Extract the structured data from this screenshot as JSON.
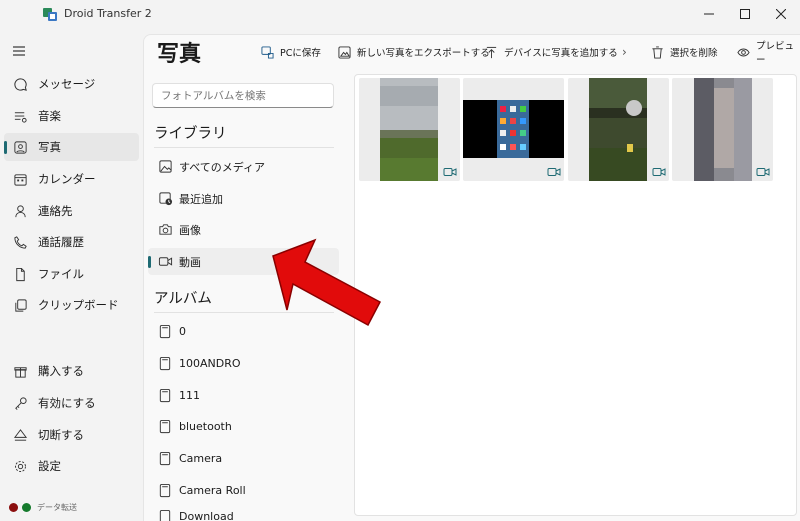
{
  "app": {
    "title": "Droid Transfer 2"
  },
  "colors": {
    "accent": "#1e6a73",
    "arrow": "#e10b0b",
    "status_red": "#8b0e0e",
    "status_green": "#157a2c"
  },
  "sidebar": {
    "items": [
      {
        "label": "メッセージ",
        "icon": "chat-icon"
      },
      {
        "label": "音楽",
        "icon": "music-icon"
      },
      {
        "label": "写真",
        "icon": "photo-icon",
        "active": true
      },
      {
        "label": "カレンダー",
        "icon": "calendar-icon"
      },
      {
        "label": "連絡先",
        "icon": "person-icon"
      },
      {
        "label": "通話履歴",
        "icon": "phone-icon"
      },
      {
        "label": "ファイル",
        "icon": "file-icon"
      },
      {
        "label": "クリップボード",
        "icon": "clipboard-icon"
      }
    ],
    "bottom_items": [
      {
        "label": "購入する",
        "icon": "gift-icon"
      },
      {
        "label": "有効にする",
        "icon": "key-icon"
      },
      {
        "label": "切断する",
        "icon": "eject-icon"
      },
      {
        "label": "設定",
        "icon": "gear-icon"
      }
    ],
    "status_label": "データ転送"
  },
  "page": {
    "title": "写真"
  },
  "toolbar": {
    "save_pc": "PCに保存",
    "export_new": "新しい写真をエクスポートする",
    "add_to_device": "デバイスに写真を追加する",
    "more": "›",
    "delete_selected": "選択を削除",
    "preview": "プレビュー"
  },
  "search": {
    "placeholder": "フォトアルバムを検索"
  },
  "library": {
    "heading": "ライブラリ",
    "items": [
      {
        "label": "すべてのメディア",
        "icon": "image-icon"
      },
      {
        "label": "最近追加",
        "icon": "recent-icon"
      },
      {
        "label": "画像",
        "icon": "camera-icon"
      },
      {
        "label": "動画",
        "icon": "video-icon",
        "active": true
      }
    ]
  },
  "albums": {
    "heading": "アルバム",
    "items": [
      {
        "label": "0"
      },
      {
        "label": "100ANDRO"
      },
      {
        "label": "111"
      },
      {
        "label": "bluetooth"
      },
      {
        "label": "Camera"
      },
      {
        "label": "Camera Roll"
      },
      {
        "label": "Download"
      }
    ]
  },
  "media_tiles": [
    {
      "type": "video",
      "scene": "field-sky"
    },
    {
      "type": "video",
      "scene": "phone-screen"
    },
    {
      "type": "video",
      "scene": "garden-night"
    },
    {
      "type": "video",
      "scene": "blurred-person"
    }
  ]
}
